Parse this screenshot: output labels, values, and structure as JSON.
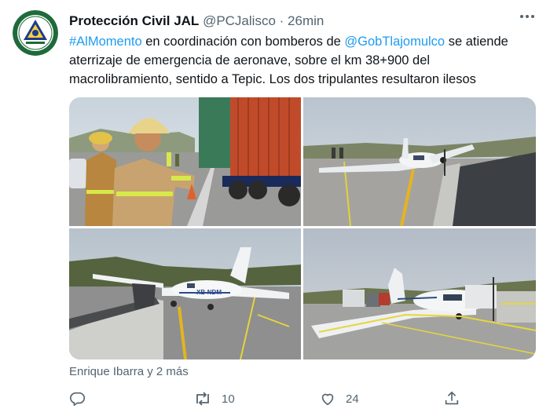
{
  "tweet": {
    "author_name": "Protección Civil JAL",
    "author_handle": "@PCJalisco",
    "separator": "·",
    "time": "26min",
    "hashtag": "#AlMomento",
    "text_part1": " en coordinación con bomberos de ",
    "mention": "@GobTlajomulco",
    "text_part2": " se atiende aterrizaje de emergencia de aeronave, sobre el km 38+900 del macrolibramiento, sentido a Tepic. Los dos tripulantes resultaron ilesos",
    "liked_by": "Enrique Ibarra y 2 más",
    "plane_registration": "XB-NDM"
  },
  "actions": {
    "reply_count": "",
    "retweet_count": "10",
    "like_count": "24"
  },
  "colors": {
    "link": "#1d9bf0",
    "secondary_text": "#536471",
    "avatar_ring": "#1f6a3b"
  },
  "icons": [
    "more-dots-icon",
    "reply-icon",
    "retweet-icon",
    "like-icon",
    "share-icon"
  ]
}
